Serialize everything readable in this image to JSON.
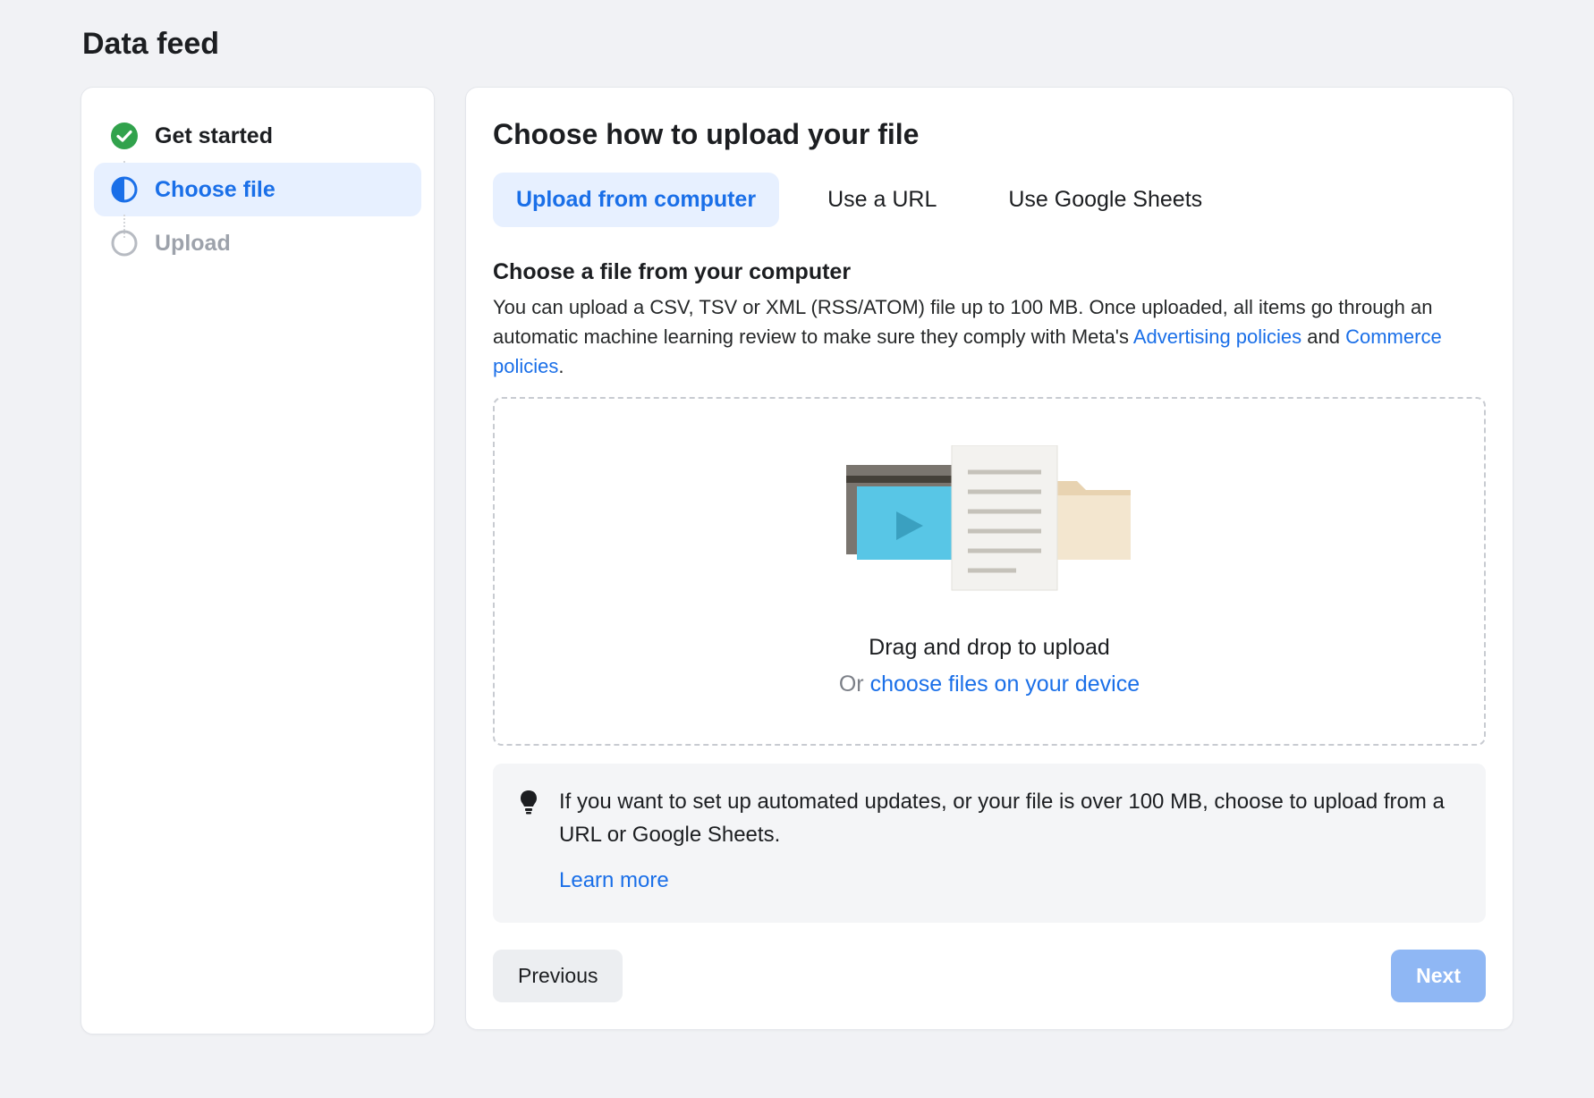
{
  "page_title": "Data feed",
  "sidebar": {
    "steps": [
      {
        "label": "Get started",
        "state": "completed"
      },
      {
        "label": "Choose file",
        "state": "active"
      },
      {
        "label": "Upload",
        "state": "pending"
      }
    ]
  },
  "main": {
    "title": "Choose how to upload your file",
    "tabs": [
      {
        "label": "Upload from computer",
        "active": true
      },
      {
        "label": "Use a URL",
        "active": false
      },
      {
        "label": "Use Google Sheets",
        "active": false
      }
    ],
    "section_subtitle": "Choose a file from your computer",
    "description_pre": "You can upload a CSV, TSV or XML (RSS/ATOM) file up to 100 MB. Once uploaded, all items go through an automatic machine learning review to make sure they comply with Meta's ",
    "link_ad_policies": "Advertising policies",
    "description_mid": " and ",
    "link_commerce_policies": "Commerce policies",
    "description_post": ".",
    "dropzone": {
      "primary": "Drag and drop to upload",
      "or_text": "Or ",
      "choose_link": "choose files on your device"
    },
    "tip": {
      "text": "If you want to set up automated updates, or your file is over 100 MB, choose to upload from a URL or Google Sheets.",
      "learn_more": "Learn more"
    },
    "buttons": {
      "previous": "Previous",
      "next": "Next"
    }
  },
  "colors": {
    "accent": "#1a6fe8",
    "success": "#31a24c"
  }
}
